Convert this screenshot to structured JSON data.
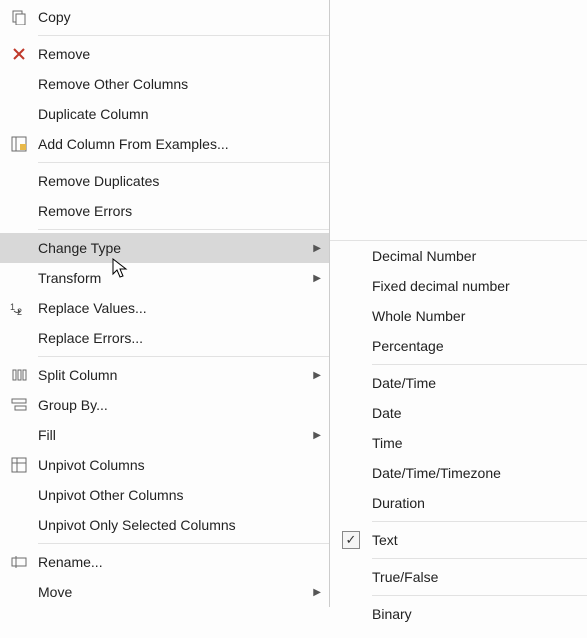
{
  "menu": {
    "copy": "Copy",
    "remove": "Remove",
    "remove_other": "Remove Other Columns",
    "duplicate": "Duplicate Column",
    "add_from_examples": "Add Column From Examples...",
    "remove_dup": "Remove Duplicates",
    "remove_err": "Remove Errors",
    "change_type": "Change Type",
    "transform": "Transform",
    "replace_vals": "Replace Values...",
    "replace_errs": "Replace Errors...",
    "split_col": "Split Column",
    "group_by": "Group By...",
    "fill": "Fill",
    "unpivot": "Unpivot Columns",
    "unpivot_other": "Unpivot Other Columns",
    "unpivot_only": "Unpivot Only Selected Columns",
    "rename": "Rename...",
    "move": "Move"
  },
  "submenu": {
    "decimal": "Decimal Number",
    "fixed_decimal": "Fixed decimal number",
    "whole": "Whole Number",
    "percentage": "Percentage",
    "datetime": "Date/Time",
    "date": "Date",
    "time": "Time",
    "dtz": "Date/Time/Timezone",
    "duration": "Duration",
    "text": "Text",
    "truefalse": "True/False",
    "binary": "Binary"
  },
  "arrow_glyph": "▶",
  "check_glyph": "✓"
}
